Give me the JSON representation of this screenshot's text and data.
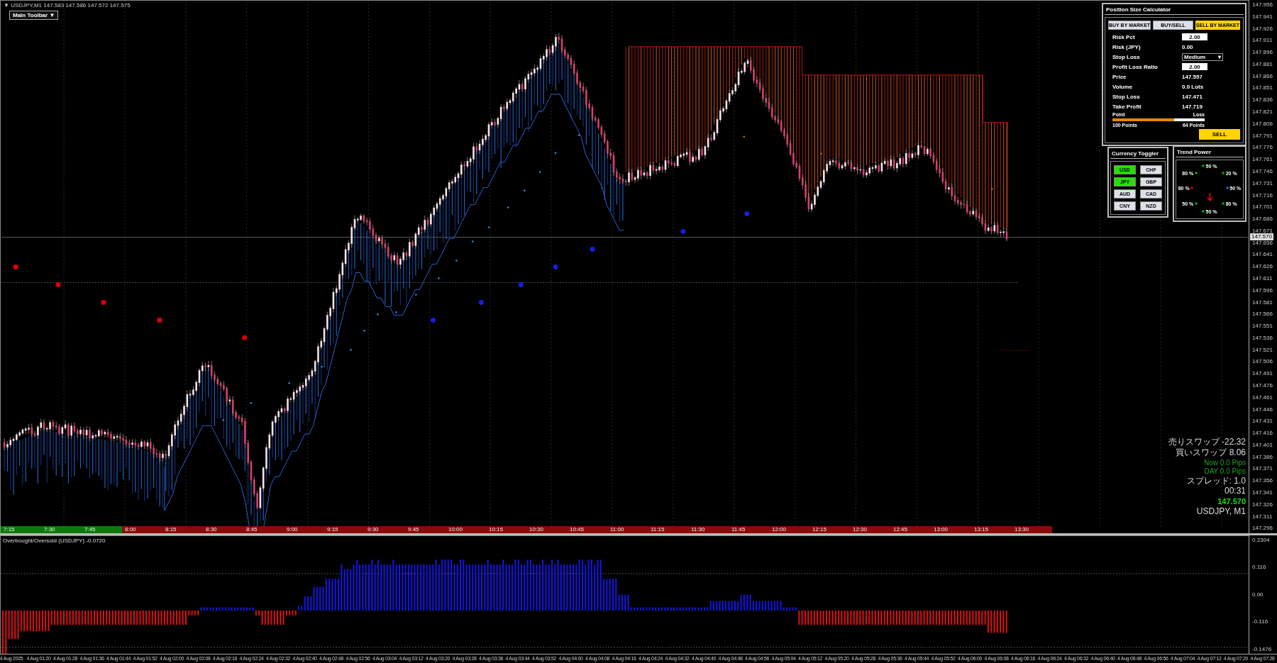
{
  "symbol_header": {
    "collapse_glyph": "▼",
    "text": "USDJPY,M1  147.583 147.586 147.572 147.575"
  },
  "toolbar_button": {
    "label": "Main Toolbar",
    "glyph": "▼"
  },
  "price_axis": {
    "labels": [
      "147.956",
      "147.941",
      "147.926",
      "147.911",
      "147.896",
      "147.881",
      "147.866",
      "147.851",
      "147.836",
      "147.821",
      "147.806",
      "147.791",
      "147.776",
      "147.761",
      "147.746",
      "147.731",
      "147.716",
      "147.701",
      "147.686",
      "147.671",
      "147.656",
      "147.641",
      "147.626",
      "147.611",
      "147.596",
      "147.581",
      "147.566",
      "147.551",
      "147.536",
      "147.521",
      "147.506",
      "147.491",
      "147.476",
      "147.461",
      "147.446",
      "147.431",
      "147.416",
      "147.401",
      "147.386",
      "147.371",
      "147.356",
      "147.341",
      "147.326",
      "147.311",
      "147.296"
    ],
    "current_price": "147.570"
  },
  "session_bar": [
    {
      "label": "7:15",
      "color": "#0b7a0b"
    },
    {
      "label": "7:30",
      "color": "#0b7a0b"
    },
    {
      "label": "7:45",
      "color": "#0b7a0b"
    },
    {
      "label": "8:00",
      "color": "#8b0a0a"
    },
    {
      "label": "8:15",
      "color": "#8b0a0a"
    },
    {
      "label": "8:30",
      "color": "#8b0a0a"
    },
    {
      "label": "8:45",
      "color": "#8b0a0a"
    },
    {
      "label": "9:00",
      "color": "#8b0a0a"
    },
    {
      "label": "9:15",
      "color": "#8b0a0a"
    },
    {
      "label": "9:30",
      "color": "#8b0a0a"
    },
    {
      "label": "9:45",
      "color": "#8b0a0a"
    },
    {
      "label": "10:00",
      "color": "#8b0a0a"
    },
    {
      "label": "10:15",
      "color": "#8b0a0a"
    },
    {
      "label": "10:30",
      "color": "#8b0a0a"
    },
    {
      "label": "10:45",
      "color": "#8b0a0a"
    },
    {
      "label": "11:00",
      "color": "#8b0a0a"
    },
    {
      "label": "11:15",
      "color": "#8b0a0a"
    },
    {
      "label": "11:30",
      "color": "#8b0a0a"
    },
    {
      "label": "11:45",
      "color": "#8b0a0a"
    },
    {
      "label": "12:00",
      "color": "#8b0a0a"
    },
    {
      "label": "12:15",
      "color": "#8b0a0a"
    },
    {
      "label": "12:30",
      "color": "#8b0a0a"
    },
    {
      "label": "12:45",
      "color": "#8b0a0a"
    },
    {
      "label": "13:00",
      "color": "#8b0a0a"
    },
    {
      "label": "13:15",
      "color": "#8b0a0a"
    },
    {
      "label": "13:30",
      "color": "#8b0a0a"
    }
  ],
  "position_size_calculator": {
    "title": "Position Size Calculator",
    "tabs": [
      {
        "label": "BUY BY MARKET",
        "selected": false
      },
      {
        "label": "BUY/SELL",
        "selected": false
      },
      {
        "label": "SELL BY MARKET",
        "selected": true
      }
    ],
    "rows": [
      {
        "label": "Risk Pct",
        "value": "2.00",
        "kind": "input"
      },
      {
        "label": "Risk (JPY)",
        "value": "0.00",
        "kind": "text"
      },
      {
        "label": "Stop Loss",
        "value": "Medium",
        "glyph": "▾",
        "kind": "dropdown"
      },
      {
        "label": "Profit Loss Ratio",
        "value": "2.00",
        "kind": "input"
      },
      {
        "label": "Price",
        "value": "147.557",
        "kind": "text"
      },
      {
        "label": "Volume",
        "value": "0.0 Lots",
        "kind": "text"
      },
      {
        "label": "Stop Loss",
        "value": "147.471",
        "kind": "text"
      },
      {
        "label": "Take Profit",
        "value": "147.719",
        "kind": "text"
      }
    ],
    "slider": {
      "left_label": "Point",
      "right_label": "Loss",
      "level": 0.67,
      "left_reading": "100 Points",
      "right_reading": "64 Points"
    },
    "action_button": "SELL"
  },
  "currency_toggler": {
    "title": "Currency Toggler",
    "currencies": [
      {
        "label": "USD",
        "on": true
      },
      {
        "label": "CHF",
        "on": false
      },
      {
        "label": "JPY",
        "on": true
      },
      {
        "label": "GBP",
        "on": false
      },
      {
        "label": "AUD",
        "on": false
      },
      {
        "label": "CAD",
        "on": false
      },
      {
        "label": "CNY",
        "on": false
      },
      {
        "label": "NZD",
        "on": false
      }
    ]
  },
  "trend_power": {
    "title": "Trend Power",
    "falling": true,
    "readings": [
      {
        "label": "50 %",
        "color": "#00c000"
      },
      {
        "label": "20 %",
        "color": "#00c000"
      },
      {
        "label": "50 %",
        "color": "#1e78ff"
      },
      {
        "label": "80 %",
        "color": "#00c000"
      },
      {
        "label": "50 %",
        "color": "#00c000"
      },
      {
        "label": "50 %",
        "color": "#00c000"
      },
      {
        "label": "80 %",
        "color": "#e00000"
      },
      {
        "label": "80 %",
        "color": "#00c000"
      }
    ]
  },
  "info": [
    {
      "text": "売りスワップ -22.32",
      "kind": "plain"
    },
    {
      "text": "買いスワップ 8.06",
      "kind": "plain"
    },
    {
      "text": "Now   0.0 Pips",
      "kind": "pips"
    },
    {
      "text": "DAY   0.0 Pips",
      "kind": "pips"
    },
    {
      "text": "スプレッド: 1.0",
      "kind": "plain"
    },
    {
      "text": "00:31",
      "kind": "plain"
    },
    {
      "text": "147.570",
      "kind": "price"
    },
    {
      "text": "USDJPY, M1",
      "kind": "symbol"
    }
  ],
  "oscillator": {
    "title": "Overbought/Oversold (USDJPY) -0.0720",
    "axis_labels": [
      "0.2304",
      "0.116",
      "0.00",
      "-0.116",
      "-0.1476"
    ]
  },
  "time_axis": [
    "4 Aug 2025",
    "4 Aug 01:20",
    "4 Aug 01:28",
    "4 Aug 01:36",
    "4 Aug 01:44",
    "4 Aug 01:52",
    "4 Aug 02:00",
    "4 Aug 02:08",
    "4 Aug 02:16",
    "4 Aug 02:24",
    "4 Aug 02:32",
    "4 Aug 02:40",
    "4 Aug 02:48",
    "4 Aug 02:56",
    "4 Aug 03:04",
    "4 Aug 03:12",
    "4 Aug 03:20",
    "4 Aug 03:28",
    "4 Aug 03:36",
    "4 Aug 03:44",
    "4 Aug 03:52",
    "4 Aug 04:00",
    "4 Aug 04:08",
    "4 Aug 04:16",
    "4 Aug 04:24",
    "4 Aug 04:32",
    "4 Aug 04:40",
    "4 Aug 04:48",
    "4 Aug 04:56",
    "4 Aug 05:04",
    "4 Aug 05:12",
    "4 Aug 05:20",
    "4 Aug 05:28",
    "4 Aug 05:36",
    "4 Aug 05:44",
    "4 Aug 05:52",
    "4 Aug 06:00",
    "4 Aug 06:08",
    "4 Aug 06:16",
    "4 Aug 06:24",
    "4 Aug 06:32",
    "4 Aug 06:40",
    "4 Aug 06:48",
    "4 Aug 06:56",
    "4 Aug 07:04",
    "4 Aug 07:12",
    "4 Aug 07:20",
    "4 Aug 07:28"
  ]
}
